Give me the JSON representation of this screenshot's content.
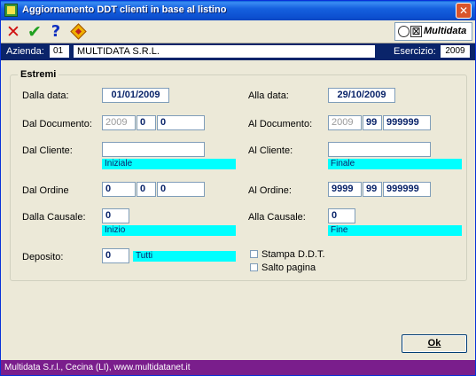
{
  "window": {
    "title": "Aggiornamento DDT clienti in base al listino",
    "close_glyph": "✕"
  },
  "toolbar": {
    "cancel_glyph": "✕",
    "confirm_glyph": "✔",
    "help_glyph": "?",
    "logo_text": "Multidata"
  },
  "azienda": {
    "label": "Azienda:",
    "code": "01",
    "name": "MULTIDATA S.R.L.",
    "esercizio_label": "Esercizio:",
    "esercizio": "2009"
  },
  "group": {
    "title": "Estremi"
  },
  "form": {
    "dalla_data": {
      "label": "Dalla data:",
      "value": "01/01/2009"
    },
    "alla_data": {
      "label": "Alla data:",
      "value": "29/10/2009"
    },
    "dal_documento": {
      "label": "Dal Documento:",
      "year": "2009",
      "series": "0",
      "number": "0"
    },
    "al_documento": {
      "label": "Al Documento:",
      "year": "2009",
      "series": "99",
      "number": "999999"
    },
    "dal_cliente": {
      "label": "Dal Cliente:",
      "value": "",
      "desc": "Iniziale"
    },
    "al_cliente": {
      "label": "Al Cliente:",
      "value": "",
      "desc": "Finale"
    },
    "dal_ordine": {
      "label": "Dal Ordine",
      "year": "0",
      "series": "0",
      "number": "0"
    },
    "al_ordine": {
      "label": "Al Ordine:",
      "year": "9999",
      "series": "99",
      "number": "999999"
    },
    "dalla_causale": {
      "label": "Dalla Causale:",
      "value": "0",
      "desc": "Inizio"
    },
    "alla_causale": {
      "label": "Alla Causale:",
      "value": "0",
      "desc": "Fine"
    },
    "deposito": {
      "label": "Deposito:",
      "value": "0",
      "desc": "Tutti"
    },
    "stampa_ddt": {
      "label": "Stampa D.D.T.",
      "checked": false
    },
    "salto_pagina": {
      "label": "Salto pagina",
      "checked": false
    }
  },
  "buttons": {
    "ok": "Ok"
  },
  "status": {
    "text": "Multidata S.r.l., Cecina (LI), www.multidatanet.it"
  },
  "colors": {
    "title_bar": "#0c4fd0",
    "azienda_bar": "#0a246a",
    "highlight": "#00ffff",
    "status_bar": "#7a1e8c"
  }
}
